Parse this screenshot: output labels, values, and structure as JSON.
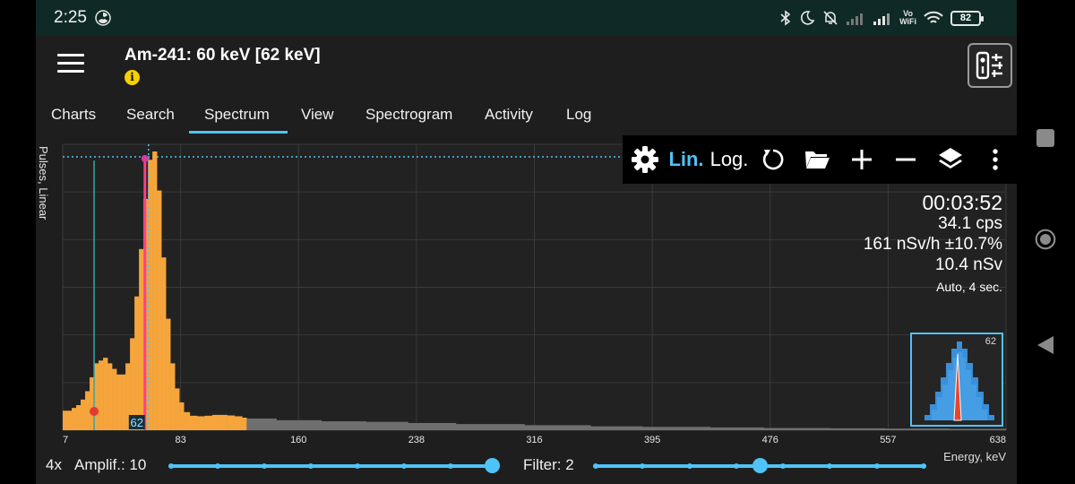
{
  "status_bar": {
    "time": "2:25",
    "battery": "82",
    "wifi_label_top": "Vo",
    "wifi_label_bottom": "WiFi"
  },
  "header": {
    "title": "Am-241: 60 keV [62 keV]",
    "info_icon": "info-icon",
    "info_glyph": "i",
    "tool_icon": "device-settings-icon"
  },
  "tabs": [
    {
      "label": "Charts"
    },
    {
      "label": "Search"
    },
    {
      "label": "Spectrum",
      "active": true
    },
    {
      "label": "View"
    },
    {
      "label": "Spectrogram"
    },
    {
      "label": "Activity"
    },
    {
      "label": "Log"
    }
  ],
  "toolbar": {
    "lin_label": "Lin.",
    "log_label": "Log."
  },
  "stats": {
    "time": "00:03:52",
    "cps": "34.1 cps",
    "dose_rate": "161 nSv/h ±10.7%",
    "dose": "10.4 nSv",
    "mode": "Auto, 4 sec."
  },
  "controls": {
    "gain": "4x",
    "amplif_label": "Amplif.: 10",
    "amplif_level": 1.0,
    "filter_label": "Filter: 2",
    "filter_level": 0.5,
    "energy_unit": "Energy, keV"
  },
  "colors": {
    "accent": "#4fc3f7",
    "spectrum": "#f5a53b",
    "marker": "#ff3d8b",
    "status_bar": "#0f2a26"
  },
  "chart_data": {
    "type": "bar",
    "ylabel": "Pulses, Linear",
    "xlabel": "Energy, keV",
    "x_ticks": [
      "7",
      "83",
      "160",
      "238",
      "316",
      "395",
      "476",
      "557",
      "638"
    ],
    "x_range": [
      7,
      638
    ],
    "scale": "linear",
    "cursor_label": "62",
    "marker_energy": 62,
    "roi_energy": 28,
    "peak_energy": 62,
    "highlight_range_keV": [
      7,
      130
    ],
    "series": [
      {
        "values": [
          [
            7,
            0.07
          ],
          [
            10,
            0.07
          ],
          [
            13,
            0.08
          ],
          [
            16,
            0.09
          ],
          [
            19,
            0.11
          ],
          [
            22,
            0.14
          ],
          [
            25,
            0.19
          ],
          [
            28,
            0.24
          ],
          [
            31,
            0.25
          ],
          [
            34,
            0.26
          ],
          [
            37,
            0.24
          ],
          [
            40,
            0.22
          ],
          [
            43,
            0.2
          ],
          [
            46,
            0.2
          ],
          [
            49,
            0.24
          ],
          [
            52,
            0.33
          ],
          [
            55,
            0.48
          ],
          [
            58,
            0.65
          ],
          [
            61,
            0.83
          ],
          [
            64,
            0.97
          ],
          [
            67,
            1.0
          ],
          [
            70,
            0.86
          ],
          [
            73,
            0.62
          ],
          [
            76,
            0.4
          ],
          [
            79,
            0.24
          ],
          [
            82,
            0.15
          ],
          [
            85,
            0.1
          ],
          [
            88,
            0.065
          ],
          [
            92,
            0.052
          ],
          [
            97,
            0.05
          ],
          [
            102,
            0.052
          ],
          [
            107,
            0.055
          ],
          [
            112,
            0.055
          ],
          [
            117,
            0.053
          ],
          [
            122,
            0.05
          ],
          [
            127,
            0.045
          ],
          [
            130,
            0.042
          ],
          [
            150,
            0.036
          ],
          [
            180,
            0.032
          ],
          [
            210,
            0.03
          ],
          [
            238,
            0.026
          ],
          [
            270,
            0.022
          ],
          [
            316,
            0.018
          ],
          [
            360,
            0.014
          ],
          [
            395,
            0.012
          ],
          [
            440,
            0.01
          ],
          [
            476,
            0.008
          ],
          [
            520,
            0.007
          ],
          [
            557,
            0.006
          ],
          [
            600,
            0.005
          ],
          [
            638,
            0.004
          ]
        ]
      }
    ]
  }
}
